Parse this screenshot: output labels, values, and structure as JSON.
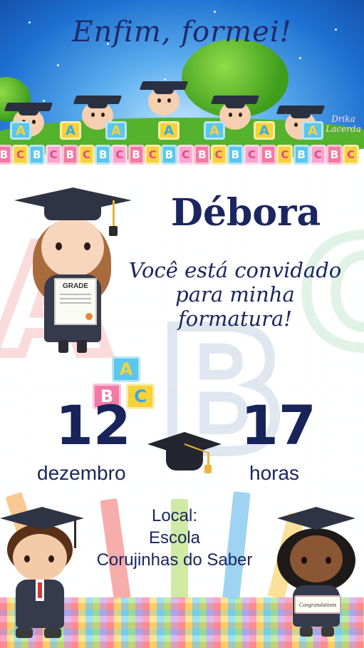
{
  "header": {
    "title": "Enfim, formei!",
    "watermark": "Drika Lacerda"
  },
  "invite": {
    "name": "Débora",
    "message_lines": [
      "Você está convidado",
      "para minha",
      "formatura!"
    ]
  },
  "event": {
    "day": "12",
    "month": "dezembro",
    "time": "17",
    "time_unit": "horas"
  },
  "location": {
    "label": "Local:",
    "lines": [
      "Escola",
      "Corujinhas do Saber"
    ]
  },
  "props": {
    "diploma_text": "GRADE",
    "sign_text": "Congratulations"
  },
  "blocks": {
    "top_row": [
      "A",
      "A",
      "A",
      "A",
      "A",
      "A",
      "A"
    ],
    "bottom_row": [
      "B",
      "C",
      "B",
      "C",
      "B",
      "C",
      "B",
      "C",
      "B",
      "C",
      "B",
      "C",
      "B",
      "C",
      "B",
      "C",
      "B",
      "C",
      "B",
      "C",
      "B",
      "C"
    ]
  },
  "colors": {
    "navy": "#1b2660",
    "sky": "#1d6fd0",
    "accent_pink": "#ff5fa0",
    "accent_yellow": "#ffd23f"
  }
}
